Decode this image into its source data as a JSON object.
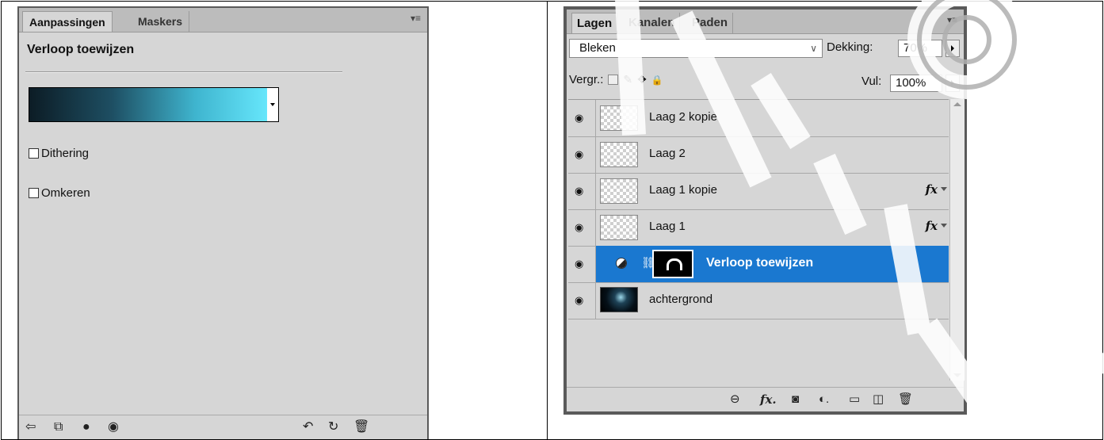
{
  "adjustments": {
    "tabs": [
      {
        "label": "Aanpassingen"
      },
      {
        "label": "Maskers"
      }
    ],
    "menu_icon": "panel-menu-icon",
    "title": "Verloop toewijzen",
    "gradient": {
      "colors": [
        "#0c1c25",
        "#1e4f63",
        "#3fb5cf",
        "#66e6fb"
      ]
    },
    "options": [
      {
        "label": "Dithering",
        "checked": false
      },
      {
        "label": "Omkeren",
        "checked": false
      }
    ],
    "bottom_icons": [
      "back-arrow-icon",
      "expand-view-icon",
      "clip-layer-icon",
      "eye-icon",
      "previous-state-icon",
      "reset-icon",
      "trash-icon"
    ]
  },
  "layers": {
    "tabs": [
      {
        "label": "Lagen"
      },
      {
        "label": "Kanalen"
      },
      {
        "label": "Paden"
      }
    ],
    "blend_mode": "Bleken",
    "opacity_label": "Dekking:",
    "opacity_value": "70%",
    "lock_label": "Vergr.:",
    "fill_label": "Vul:",
    "fill_value": "100%",
    "items": [
      {
        "name": "Laag 2 kopie",
        "fx": false,
        "visible": true
      },
      {
        "name": "Laag 2",
        "fx": false,
        "visible": true
      },
      {
        "name": "Laag 1 kopie",
        "fx": true,
        "visible": true
      },
      {
        "name": "Laag 1",
        "fx": true,
        "visible": true
      },
      {
        "name": "Verloop toewijzen",
        "fx": false,
        "visible": true,
        "selected": true
      },
      {
        "name": "achtergrond",
        "fx": false,
        "visible": true
      }
    ],
    "fx_label": "fx",
    "selection_color": "#1a78d0",
    "bottom_icons": [
      "link-icon",
      "fx-icon",
      "mask-icon",
      "adjustment-icon",
      "folder-icon",
      "new-layer-icon",
      "trash-icon"
    ]
  }
}
